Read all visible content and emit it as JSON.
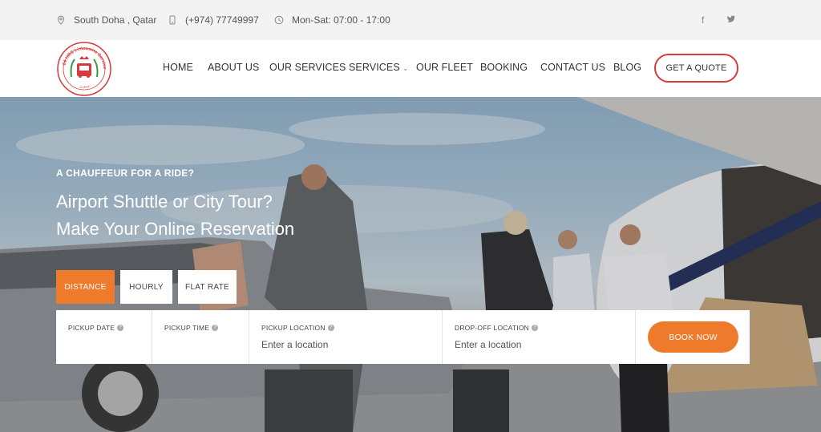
{
  "topbar": {
    "location": "South Doha , Qatar",
    "phone": "(+974) 77749997",
    "hours": "Mon-Sat: 07:00 - 17:00",
    "social": [
      "f",
      "🐦"
    ]
  },
  "header": {
    "logo_text": "24 HRS Limousine Service",
    "nav": [
      {
        "label": "HOME"
      },
      {
        "label": "ABOUT US"
      },
      {
        "label": "OUR SERVICES"
      },
      {
        "label": "SERVICES",
        "has_dropdown": true
      },
      {
        "label": "OUR FLEET"
      },
      {
        "label": "BOOKING"
      },
      {
        "label": "CONTACT US"
      },
      {
        "label": "BLOG"
      }
    ],
    "quote_label": "GET A QUOTE"
  },
  "hero": {
    "eyebrow": "A CHAUFFEUR FOR A RIDE?",
    "headline_1": "Airport Shuttle or City Tour?",
    "headline_2": "Make Your Online Reservation"
  },
  "booking": {
    "tabs": [
      {
        "label": "DISTANCE",
        "active": true
      },
      {
        "label": "HOURLY",
        "active": false
      },
      {
        "label": "FLAT RATE",
        "active": false
      }
    ],
    "fields": [
      {
        "label": "PICKUP DATE",
        "value": ""
      },
      {
        "label": "PICKUP TIME",
        "value": ""
      },
      {
        "label": "PICKUP LOCATION",
        "value": "Enter a location"
      },
      {
        "label": "DROP-OFF LOCATION",
        "value": "Enter a location"
      }
    ],
    "submit_label": "BOOK NOW"
  },
  "colors": {
    "accent": "#ee7a2b",
    "quote_border": "#d63a3a",
    "topbar_bg": "#f3f3f3"
  }
}
